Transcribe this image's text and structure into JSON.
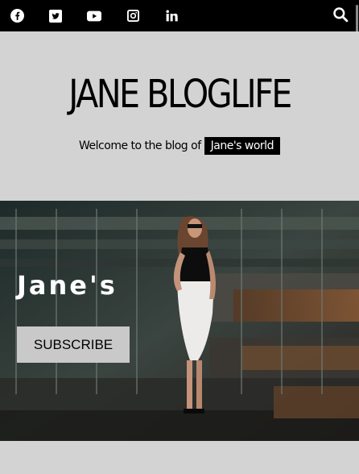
{
  "topbar": {
    "social_icons": [
      "facebook-icon",
      "twitter-icon",
      "youtube-icon",
      "instagram-icon",
      "linkedin-icon"
    ],
    "search_icon": "search-icon"
  },
  "masthead": {
    "title": "JANE BLOGLIFE",
    "tagline": "Welcome to the blog of",
    "highlight": "Jane's world"
  },
  "hero": {
    "title": "Jane's",
    "subscribe_label": "SUBSCRIBE"
  },
  "colors": {
    "topbar": "#000000",
    "page_background": "#d3d3d3",
    "highlight_background": "#000000",
    "button_background": "#c9c9c9"
  }
}
